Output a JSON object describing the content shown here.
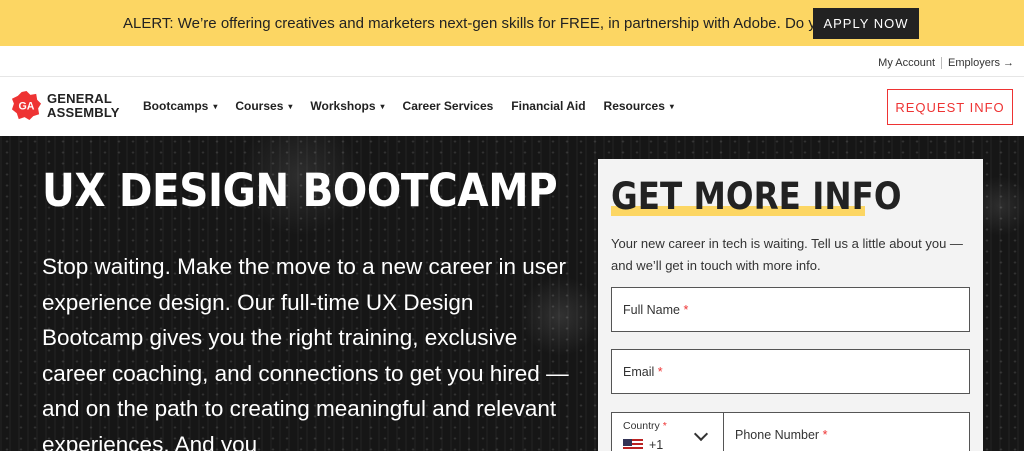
{
  "alert": {
    "text": "ALERT: We’re offering creatives and marketers next-gen skills for FREE, in partnership with Adobe. Do you qualify?",
    "button": "APPLY NOW"
  },
  "utility": {
    "my_account": "My Account",
    "employers": "Employers",
    "employers_icon": "arrow-right-icon"
  },
  "nav": {
    "logo_mark": "GA",
    "logo_line1": "GENERAL",
    "logo_line2": "ASSEMBLY",
    "items": [
      {
        "label": "Bootcamps",
        "caret": "▾"
      },
      {
        "label": "Courses",
        "caret": "▾"
      },
      {
        "label": "Workshops",
        "caret": "▾"
      },
      {
        "label": "Career Services",
        "caret": ""
      },
      {
        "label": "Financial Aid",
        "caret": ""
      },
      {
        "label": "Resources",
        "caret": "▾"
      }
    ],
    "request_button": "REQUEST INFO"
  },
  "hero": {
    "title": "UX DESIGN BOOTCAMP",
    "body": "Stop waiting. Make the move to a new career in user experience design. Our full-time UX Design Bootcamp gives you the right training, exclusive career coaching, and connections to get you hired — and on the path to creating meaningful and relevant experiences. And you"
  },
  "form": {
    "title": "GET MORE INFO",
    "description": "Your new career in tech is waiting. Tell us a little about you — and we’ll get in touch with more info.",
    "full_name_label": "Full Name",
    "email_label": "Email",
    "country_label": "Country",
    "country_code": "+1",
    "phone_label": "Phone Number",
    "required_mark": "*"
  },
  "colors": {
    "alert_bg": "#fcd663",
    "accent_red": "#e33333",
    "dark": "#222222"
  }
}
